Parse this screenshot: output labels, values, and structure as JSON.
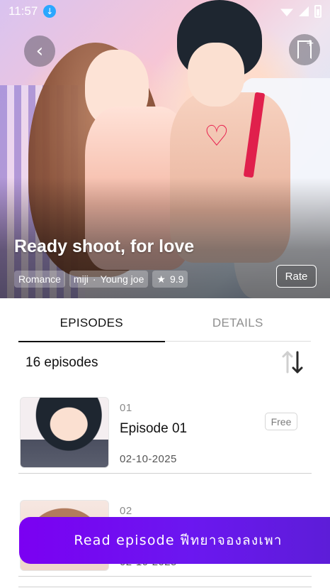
{
  "status_bar": {
    "time": "11:57"
  },
  "hero": {
    "title": "Ready shoot, for love",
    "genre": "Romance",
    "authors": [
      "miji",
      "Young joe"
    ],
    "separator": "·",
    "rating_star": "★",
    "rating": "9.9",
    "rate_label": "Rate"
  },
  "tabs": [
    {
      "label": "EPISODES",
      "active": true
    },
    {
      "label": "DETAILS",
      "active": false
    }
  ],
  "episode_count": "16 episodes",
  "episodes": [
    {
      "number": "01",
      "title": "Episode 01",
      "date": "02-10-2025",
      "badge": "Free"
    },
    {
      "number": "02",
      "title": "",
      "date": "02-10-2025",
      "badge": ""
    }
  ],
  "read_button": {
    "label": "Read episode ฟีทยาจองลงเพา"
  },
  "colors": {
    "accent": "#7b00f2",
    "text": "#111111",
    "muted": "#8a8a8a"
  },
  "icons": {
    "back": "chevron-left-icon",
    "bookmark": "bookmark-plus-icon",
    "sort": "sort-icon",
    "download": "download-icon"
  }
}
